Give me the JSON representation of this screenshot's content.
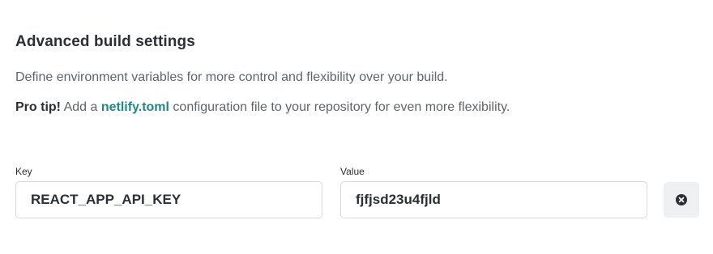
{
  "section": {
    "title": "Advanced build settings",
    "description": "Define environment variables for more control and flexibility over your build.",
    "protip": {
      "strong": "Pro tip!",
      "before_link": " Add a ",
      "link_text": "netlify.toml",
      "after_link": " configuration file to your repository for even more flexibility."
    }
  },
  "env_var": {
    "key_label": "Key",
    "key_value": "REACT_APP_API_KEY",
    "value_label": "Value",
    "value_value": "fjfjsd23u4fjld"
  },
  "icons": {
    "remove": "close-circle-icon"
  },
  "colors": {
    "link": "#1f8a86",
    "heading": "#2b2f36",
    "muted_text": "#5f656d",
    "input_border": "#d6dadf",
    "button_bg": "#eef0f2"
  }
}
